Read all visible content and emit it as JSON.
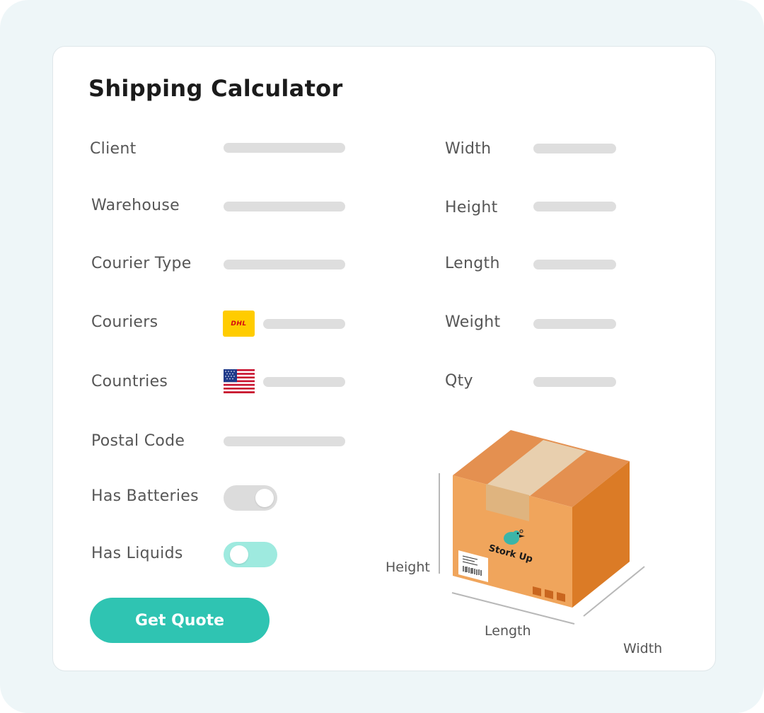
{
  "title": "Shipping Calculator",
  "left_fields": [
    {
      "label": "Client"
    },
    {
      "label": "Warehouse"
    },
    {
      "label": "Courier Type"
    },
    {
      "label": "Couriers",
      "icon": "dhl-logo",
      "logo_text": "DHL"
    },
    {
      "label": "Countries",
      "icon": "us-flag"
    },
    {
      "label": "Postal Code"
    }
  ],
  "right_fields": [
    {
      "label": "Width"
    },
    {
      "label": "Height"
    },
    {
      "label": "Length"
    },
    {
      "label": "Weight"
    },
    {
      "label": "Qty"
    }
  ],
  "toggles": [
    {
      "label": "Has Batteries",
      "on": false,
      "color": "#dcdcdc"
    },
    {
      "label": "Has Liquids",
      "on": true,
      "color": "#9eeadf"
    }
  ],
  "button": {
    "label": "Get Quote",
    "color": "#2fc4b2"
  },
  "illustration": {
    "brand": "Stork Up",
    "dim_height": "Height",
    "dim_length": "Length",
    "dim_width": "Width"
  },
  "colors": {
    "accent": "#2fc4b2",
    "background": "#eef6f8",
    "box": "#f0a55c"
  }
}
